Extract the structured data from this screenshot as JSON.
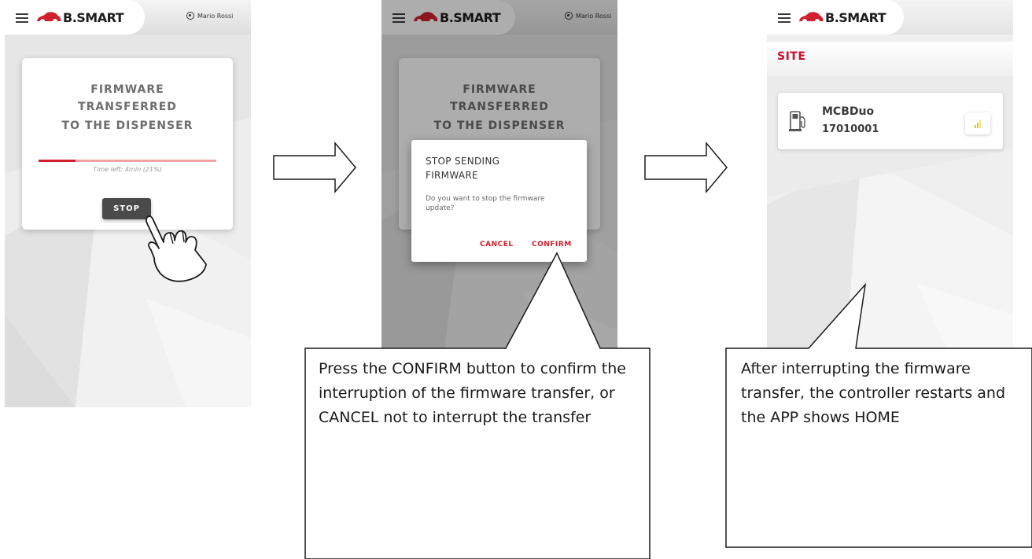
{
  "app": {
    "brand": "B.SMART",
    "user_name": "Mario Rossi",
    "accent_color": "#c8102e"
  },
  "screen1": {
    "card_title_lines": [
      "FIRMWARE",
      "TRANSFERRED",
      "TO THE DISPENSER"
    ],
    "progress_fraction": 0.21,
    "time_left": "Time left: 4min (21%)",
    "stop_label": "STOP"
  },
  "screen2": {
    "card_title_lines": [
      "FIRMWARE",
      "TRANSFERRED",
      "TO THE DISPENSER"
    ],
    "dialog": {
      "title": "STOP SENDING FIRMWARE",
      "message": "Do you want to stop the firmware update?",
      "cancel_label": "CANCEL",
      "confirm_label": "CONFIRM"
    }
  },
  "screen3": {
    "section_label": "SITE",
    "device": {
      "name": "MCBDuo",
      "id": "17010001",
      "icon": "fuel-pump-icon",
      "status_icon": "signal-bars-icon"
    }
  },
  "callouts": {
    "confirm_note": "Press the CONFIRM button to confirm the interruption of the firmware transfer, or CANCEL not to interrupt the transfer",
    "home_note": "After interrupting the firmware transfer, the controller restarts and the APP shows HOME"
  }
}
